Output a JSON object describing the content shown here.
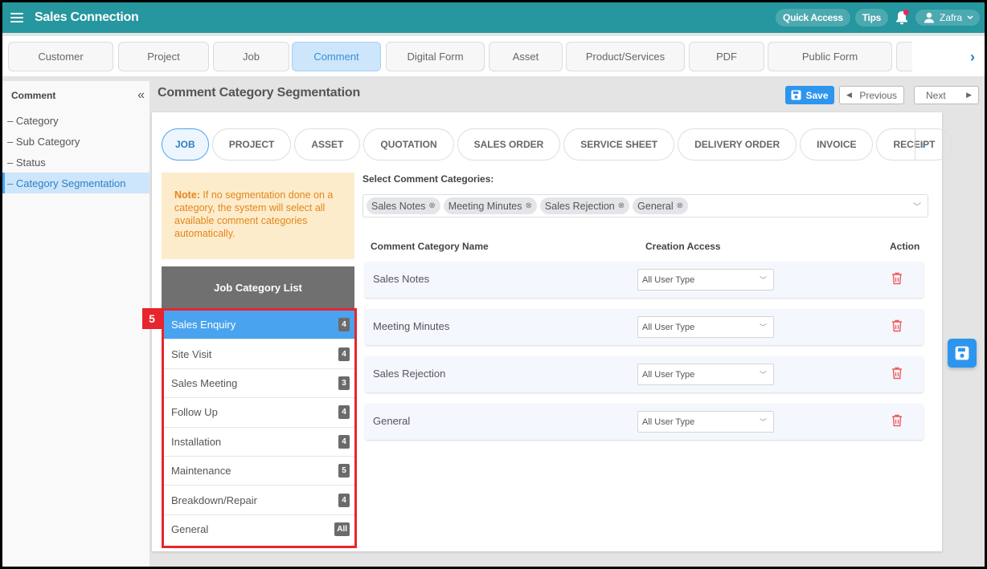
{
  "app": {
    "title": "Sales Connection",
    "quick_access": "Quick Access",
    "tips": "Tips",
    "user": "Zafra",
    "notification_dot_color": "#e8295c"
  },
  "module_tabs": [
    {
      "label": "Customer"
    },
    {
      "label": "Project"
    },
    {
      "label": "Job"
    },
    {
      "label": "Comment",
      "active": true
    },
    {
      "label": "Digital Form"
    },
    {
      "label": "Asset"
    },
    {
      "label": "Product/Services"
    },
    {
      "label": "PDF"
    },
    {
      "label": "Public Form"
    }
  ],
  "sidebar": {
    "title": "Comment",
    "collapse_icon": "«",
    "items": [
      {
        "label": "– Category"
      },
      {
        "label": "– Sub Category"
      },
      {
        "label": "– Status"
      },
      {
        "label": "– Category Segmentation",
        "active": true
      }
    ]
  },
  "header": {
    "title": "Comment Category Segmentation",
    "save": "Save",
    "previous": "Previous",
    "next": "Next"
  },
  "doc_tabs": [
    {
      "label": "JOB",
      "active": true
    },
    {
      "label": "PROJECT"
    },
    {
      "label": "ASSET"
    },
    {
      "label": "QUOTATION"
    },
    {
      "label": "SALES ORDER"
    },
    {
      "label": "SERVICE SHEET"
    },
    {
      "label": "DELIVERY ORDER"
    },
    {
      "label": "INVOICE"
    },
    {
      "label": "RECEIPT"
    }
  ],
  "note": {
    "prefix": "Note:",
    "text": " If no segmentation done on a category, the system will select all available comment categories automatically."
  },
  "job_list": {
    "title": "Job Category List",
    "step_badge": "5",
    "items": [
      {
        "label": "Sales Enquiry",
        "count": "4",
        "active": true
      },
      {
        "label": "Site Visit",
        "count": "4"
      },
      {
        "label": "Sales Meeting",
        "count": "3"
      },
      {
        "label": "Follow Up",
        "count": "4"
      },
      {
        "label": "Installation",
        "count": "4"
      },
      {
        "label": "Maintenance",
        "count": "5"
      },
      {
        "label": "Breakdown/Repair",
        "count": "4"
      },
      {
        "label": "General",
        "count": "All"
      }
    ]
  },
  "select_categories": {
    "label": "Select Comment Categories:",
    "chips": [
      "Sales Notes",
      "Meeting Minutes",
      "Sales Rejection",
      "General"
    ]
  },
  "table": {
    "col_name": "Comment Category Name",
    "col_access": "Creation Access",
    "col_action": "Action",
    "rows": [
      {
        "name": "Sales Notes",
        "access": "All User Type"
      },
      {
        "name": "Meeting Minutes",
        "access": "All User Type"
      },
      {
        "name": "Sales Rejection",
        "access": "All User Type"
      },
      {
        "name": "General",
        "access": "All User Type"
      }
    ]
  },
  "colors": {
    "topbar": "#26969f",
    "accent": "#2d95ee",
    "highlight_border": "#e8242d",
    "delete_icon": "#f05a5a",
    "note_text": "#e2861d",
    "note_bg": "#fdeccb"
  }
}
